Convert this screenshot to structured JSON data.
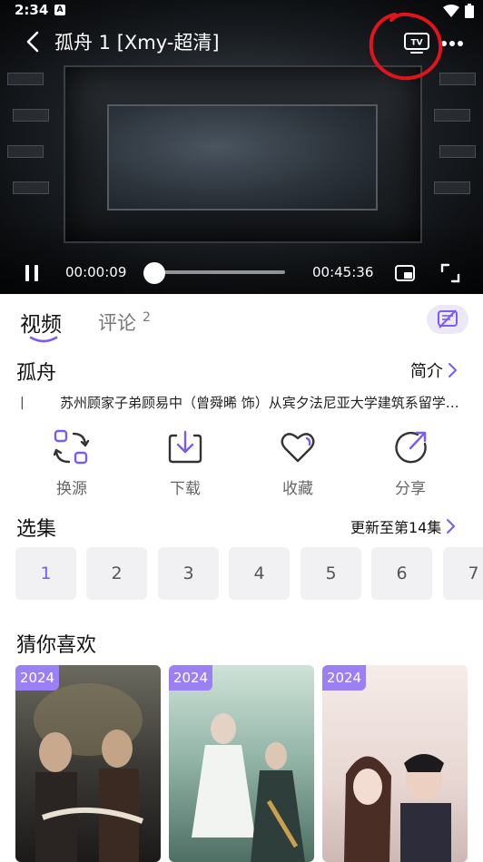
{
  "status_bar": {
    "time": "2:34",
    "notif_letter": "A"
  },
  "player": {
    "title": "孤舟 1 [Xmy-超清]",
    "current_time": "00:00:09",
    "total_time": "00:45:36",
    "progress_fraction": 0.003,
    "tv_label": "TV"
  },
  "tabs": [
    {
      "label": "视频",
      "active": true
    },
    {
      "label": "评论",
      "count": "2",
      "active": false
    }
  ],
  "show": {
    "title": "孤舟",
    "intro_label": "简介",
    "description_bar": "|",
    "description": "苏州顾家子弟顾易中（曾舜晞 饰）从宾夕法尼亚大学建筑系留学归来，却卷入一场风波"
  },
  "actions": [
    {
      "label": "换源",
      "icon": "switch-source-icon"
    },
    {
      "label": "下载",
      "icon": "download-icon"
    },
    {
      "label": "收藏",
      "icon": "heart-icon"
    },
    {
      "label": "分享",
      "icon": "share-icon"
    }
  ],
  "episodes": {
    "title": "选集",
    "update_label": "更新至第14集",
    "items": [
      "1",
      "2",
      "3",
      "4",
      "5",
      "6",
      "7"
    ],
    "active_index": 0
  },
  "recommendations": {
    "title": "猜你喜欢",
    "items": [
      {
        "year": "2024"
      },
      {
        "year": "2024"
      },
      {
        "year": "2024"
      }
    ]
  },
  "colors": {
    "accent": "#7b5cf0",
    "badge": "#9b7ff5",
    "annotation": "#e0141a"
  }
}
